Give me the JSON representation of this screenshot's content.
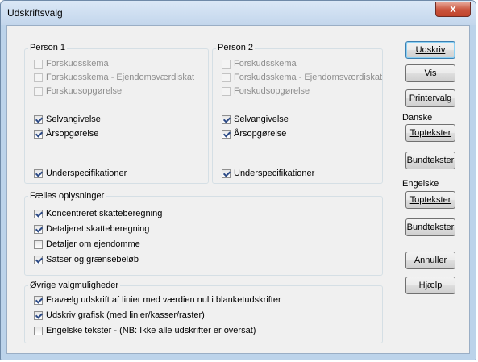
{
  "window": {
    "title": "Udskriftsvalg",
    "close_icon": "x"
  },
  "person1": {
    "label": "Person 1",
    "items": [
      {
        "label": "Forskudsskema",
        "checked": false,
        "enabled": false
      },
      {
        "label": "Forskudsskema - Ejendomsværdiskat",
        "checked": false,
        "enabled": false
      },
      {
        "label": "Forskudsopgørelse",
        "checked": false,
        "enabled": false
      },
      {
        "label": "Selvangivelse",
        "checked": true,
        "enabled": true
      },
      {
        "label": "Årsopgørelse",
        "checked": true,
        "enabled": true
      },
      {
        "label": "Underspecifikationer",
        "checked": true,
        "enabled": true
      }
    ]
  },
  "person2": {
    "label": "Person 2",
    "items": [
      {
        "label": "Forskudsskema",
        "checked": false,
        "enabled": false
      },
      {
        "label": "Forskudsskema - Ejendomsværdiskat",
        "checked": false,
        "enabled": false
      },
      {
        "label": "Forskudsopgørelse",
        "checked": false,
        "enabled": false
      },
      {
        "label": "Selvangivelse",
        "checked": true,
        "enabled": true
      },
      {
        "label": "Årsopgørelse",
        "checked": true,
        "enabled": true
      },
      {
        "label": "Underspecifikationer",
        "checked": true,
        "enabled": true
      }
    ]
  },
  "faelles": {
    "label": "Fælles oplysninger",
    "items": [
      {
        "label": "Koncentreret skatteberegning",
        "checked": true
      },
      {
        "label": "Detaljeret skatteberegning",
        "checked": true
      },
      {
        "label": "Detaljer om ejendomme",
        "checked": false
      },
      {
        "label": "Satser og grænsebeløb",
        "checked": true
      }
    ]
  },
  "ovrige": {
    "label": "Øvrige valgmuligheder",
    "items": [
      {
        "label": "Fravælg udskrift af linier med værdien nul i blanketudskrifter",
        "checked": true
      },
      {
        "label": "Udskriv grafisk (med linier/kasser/raster)",
        "checked": true
      },
      {
        "label": "Engelske tekster - (NB: Ikke alle udskrifter er oversat)",
        "checked": false
      }
    ]
  },
  "buttons": {
    "udskriv": "Udskriv",
    "vis": "Vis",
    "printervalg": "Printervalg",
    "danske_label": "Danske",
    "danske_toptekster": "Toptekster",
    "danske_bundtekster": "Bundtekster",
    "engelske_label": "Engelske",
    "engelske_toptekster": "Toptekster",
    "engelske_bundtekster": "Bundtekster",
    "annuller": "Annuller",
    "hjaelp": "Hjælp"
  }
}
